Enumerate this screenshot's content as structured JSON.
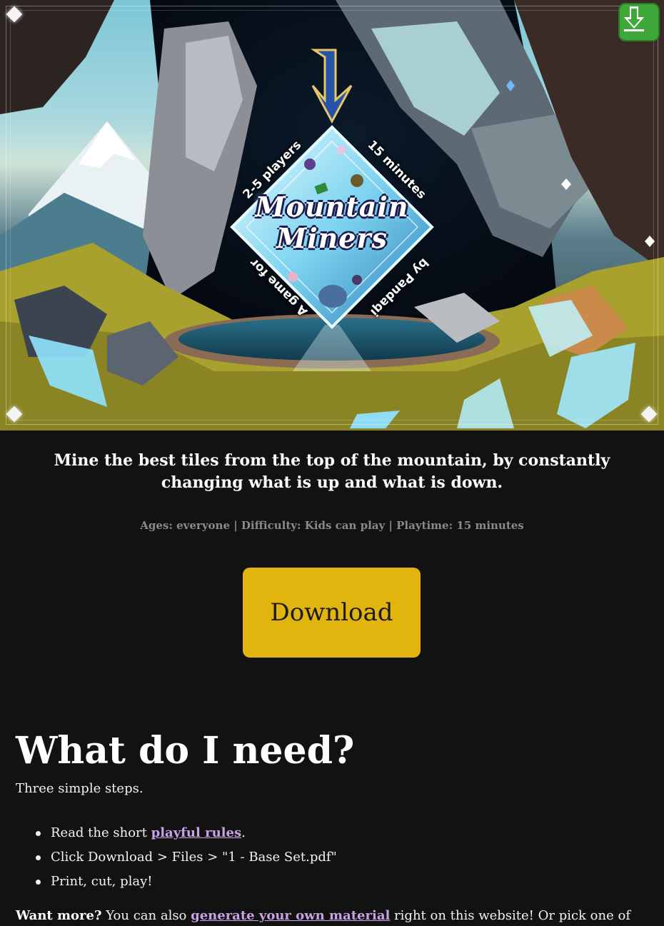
{
  "hero": {
    "logo_line1": "Mountain",
    "logo_line2": "Miners",
    "label_players": "2-5 players",
    "label_time": "15 minutes",
    "label_game_for": "A game for",
    "label_by": "by Pandaqi",
    "download_icon": "download-arrow-icon"
  },
  "tagline": "Mine the best tiles from the top of the mountain, by constantly changing what is up and what is down.",
  "meta": "Ages: everyone | Difficulty: Kids can play | Playtime: 15 minutes",
  "download_button": "Download",
  "section": {
    "heading": "What do I need?",
    "intro": "Three simple steps.",
    "step1_before": "Read the short ",
    "step1_link": "playful rules",
    "step1_after": ".",
    "step2": "Click Download > Files > \"1 - Base Set.pdf\"",
    "step3": "Print, cut, play!",
    "more_bold": "Want more?",
    "more_before": " You can also ",
    "more_link": "generate your own material",
    "more_after": " right on this website! Or pick one of"
  },
  "colors": {
    "background": "#121212",
    "button": "#e2b40e",
    "link": "#c9a2e6",
    "meta": "#8a8a8a"
  }
}
